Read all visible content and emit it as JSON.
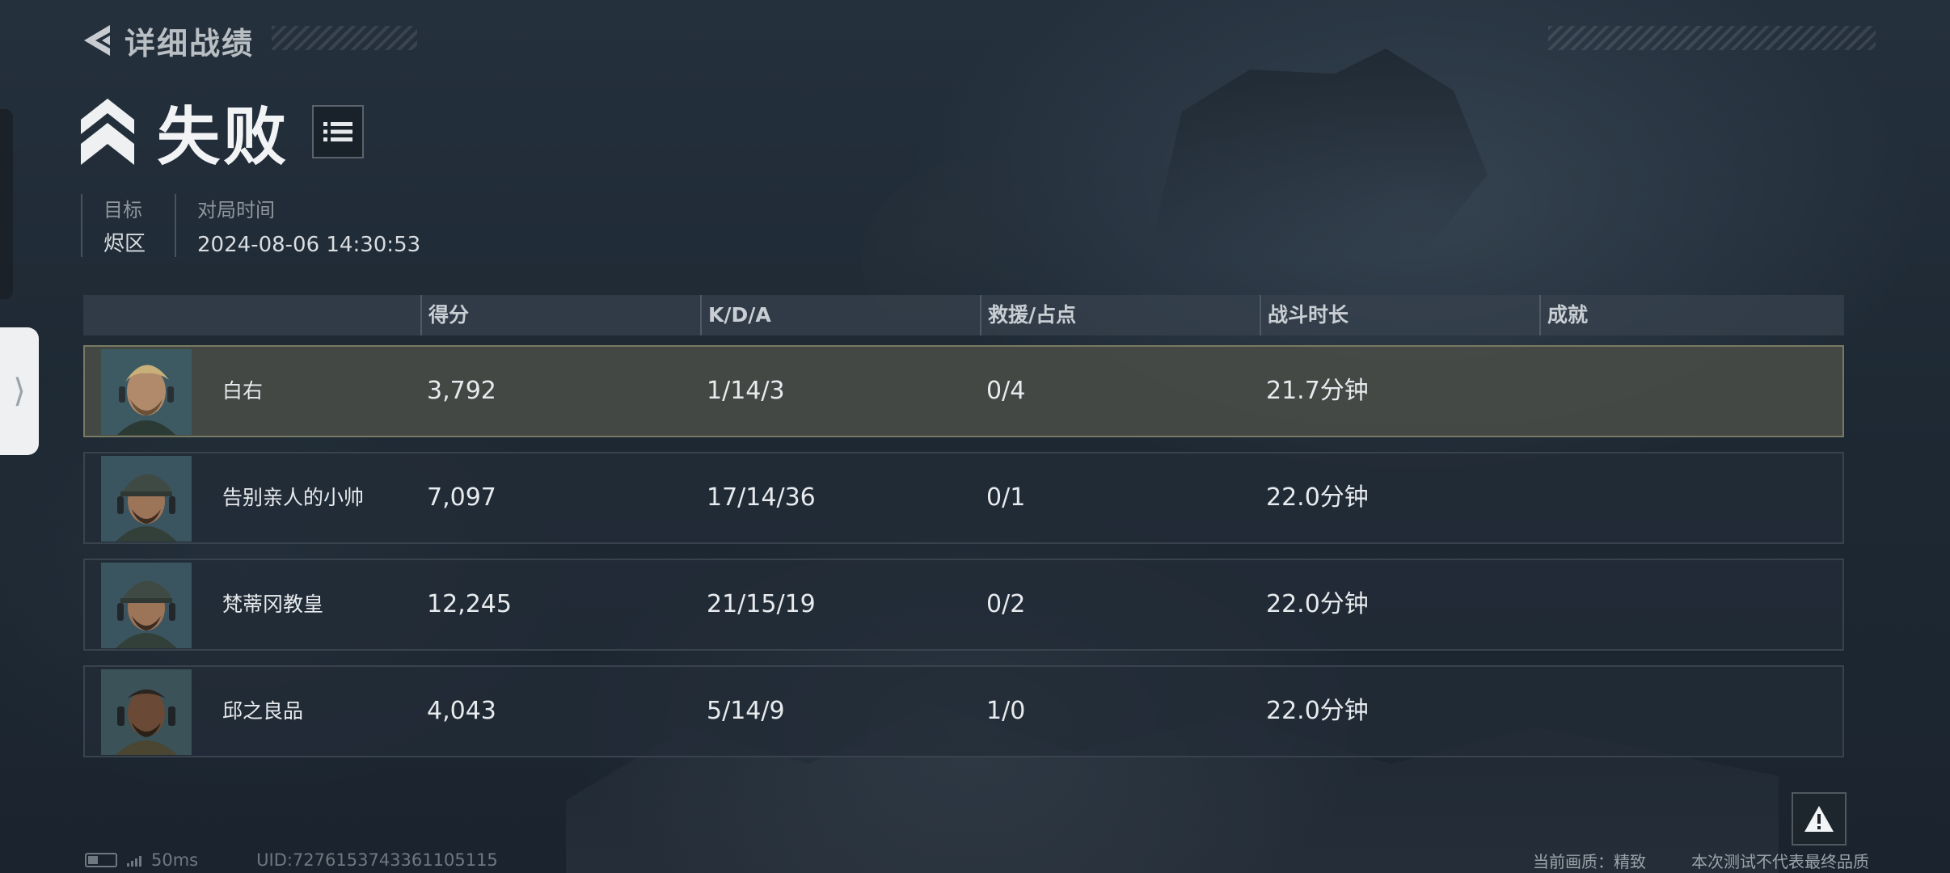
{
  "header": {
    "back_title": "详细战绩",
    "result": "失败"
  },
  "meta": {
    "target_label": "目标",
    "target_value": "烬区",
    "time_label": "对局时间",
    "time_value": "2024-08-06 14:30:53"
  },
  "table": {
    "columns": [
      "得分",
      "K/D/A",
      "救援/占点",
      "战斗时长",
      "成就"
    ],
    "rows": [
      {
        "name": "白右",
        "score": "3,792",
        "kda": "1/14/3",
        "rescue": "0/4",
        "duration": "21.7分钟",
        "achievement": ""
      },
      {
        "name": "告别亲人的小帅",
        "score": "7,097",
        "kda": "17/14/36",
        "rescue": "0/1",
        "duration": "22.0分钟",
        "achievement": ""
      },
      {
        "name": "梵蒂冈教皇",
        "score": "12,245",
        "kda": "21/15/19",
        "rescue": "0/2",
        "duration": "22.0分钟",
        "achievement": ""
      },
      {
        "name": "邱之良品",
        "score": "4,043",
        "kda": "5/14/9",
        "rescue": "1/0",
        "duration": "22.0分钟",
        "achievement": ""
      }
    ]
  },
  "footer": {
    "ping": "50ms",
    "uid": "UID:7276153743361105115",
    "quality": "当前画质：精致",
    "disclaimer": "本次测试不代表最终品质"
  },
  "icons": {
    "back": "back-arrow-icon",
    "rank": "chevron-rank-icon",
    "list": "list-icon",
    "report": "warning-icon",
    "side": "chevron-right-icon"
  },
  "colors": {
    "highlight_row": "#4a4e48",
    "highlight_border": "#777a60",
    "row_bg": "#232d38"
  }
}
